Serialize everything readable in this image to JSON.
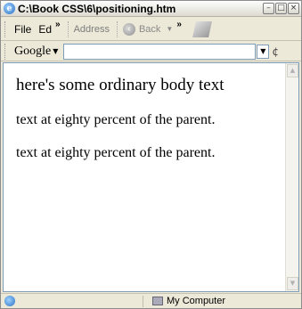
{
  "window": {
    "title": "C:\\Book CSS\\6\\positioning.htm",
    "title_buttons": [
      "minimize",
      "maximize",
      "close"
    ]
  },
  "menubar": {
    "file_label": "File",
    "edit_label": "Ed",
    "address_label": "Address",
    "back_label": "Back"
  },
  "google_toolbar": {
    "label": "Google",
    "search_value": ""
  },
  "page": {
    "line1": "here's some ordinary body text",
    "para2": "text at eighty percent of the parent.",
    "para3": "text at eighty percent of the parent."
  },
  "statusbar": {
    "left_text": "",
    "zone_label": "My Computer"
  }
}
